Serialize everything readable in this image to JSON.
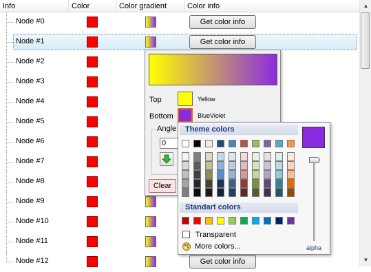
{
  "columns": [
    "Info",
    "Color",
    "Color gradient",
    "Color info"
  ],
  "rows": [
    {
      "label": "Node #0",
      "color": true,
      "gradient": true,
      "button": "Get color info"
    },
    {
      "label": "Node #1",
      "color": true,
      "gradient": true,
      "button": "Get color info",
      "selected": true
    },
    {
      "label": "Node #2",
      "color": true,
      "gradient": false,
      "button": ""
    },
    {
      "label": "Node #3",
      "color": true,
      "gradient": false,
      "button": ""
    },
    {
      "label": "Node #4",
      "color": true,
      "gradient": false,
      "button": ""
    },
    {
      "label": "Node #5",
      "color": true,
      "gradient": false,
      "button": ""
    },
    {
      "label": "Node #6",
      "color": true,
      "gradient": false,
      "button": ""
    },
    {
      "label": "Node #7",
      "color": true,
      "gradient": false,
      "button": ""
    },
    {
      "label": "Node #8",
      "color": true,
      "gradient": false,
      "button": ""
    },
    {
      "label": "Node #9",
      "color": true,
      "gradient": true,
      "button": ""
    },
    {
      "label": "Node #10",
      "color": true,
      "gradient": true,
      "button": ""
    },
    {
      "label": "Node #11",
      "color": true,
      "gradient": true,
      "button": ""
    },
    {
      "label": "Node #12",
      "color": true,
      "gradient": true,
      "button": "Get color info"
    }
  ],
  "colors": {
    "node_color": "#ff0000",
    "gradient_top": "#ffff00",
    "gradient_bottom": "#8a2be2",
    "selection": "#d9ecf7"
  },
  "gradient_editor": {
    "top_label": "Top",
    "top_name": "Yellow",
    "bottom_label": "Bottom",
    "bottom_name": "BlueViolet",
    "angle_label": "Angle",
    "angle_value": "0",
    "clear_label": "Clear",
    "arrow_icon": "green-down-arrow-icon"
  },
  "color_picker": {
    "theme_title": "Theme colors",
    "theme_base": [
      "#ffffff",
      "#000000",
      "#eeece1",
      "#1f497d",
      "#4f81bd",
      "#c0504d",
      "#9bbb59",
      "#8064a2",
      "#4bacc6",
      "#f79646"
    ],
    "theme_shades": [
      [
        "#f2f2f2",
        "#d8d8d8",
        "#bfbfbf",
        "#a5a5a5",
        "#7f7f7f"
      ],
      [
        "#7f7f7f",
        "#595959",
        "#3f3f3f",
        "#262626",
        "#0c0c0c"
      ],
      [
        "#ddd9c3",
        "#c4bd97",
        "#938953",
        "#494429",
        "#1d1b10"
      ],
      [
        "#c6d9f0",
        "#8db3e2",
        "#548dd4",
        "#17365d",
        "#0f243e"
      ],
      [
        "#dbe5f1",
        "#b8cce4",
        "#95b3d7",
        "#366092",
        "#244061"
      ],
      [
        "#f2dcdb",
        "#e5b9b7",
        "#d99694",
        "#953734",
        "#632423"
      ],
      [
        "#ebf1dd",
        "#d7e3bc",
        "#c3d69b",
        "#76923c",
        "#4f6128"
      ],
      [
        "#e5e0ec",
        "#ccc1d9",
        "#b2a2c7",
        "#5f497a",
        "#3f3151"
      ],
      [
        "#dbeef3",
        "#b7dde8",
        "#92cddc",
        "#31859b",
        "#205867"
      ],
      [
        "#fdeada",
        "#fbd5b5",
        "#fac08f",
        "#e36c09",
        "#974806"
      ]
    ],
    "standard_title": "Standart colors",
    "standard": [
      "#c00000",
      "#ff0000",
      "#ffc000",
      "#ffff00",
      "#92d050",
      "#00b050",
      "#00b0f0",
      "#0070c0",
      "#002060",
      "#7030a0"
    ],
    "transparent_label": "Transparent",
    "more_label": "More colors...",
    "current_color": "#8a2be2",
    "alpha_label": "alpha"
  }
}
